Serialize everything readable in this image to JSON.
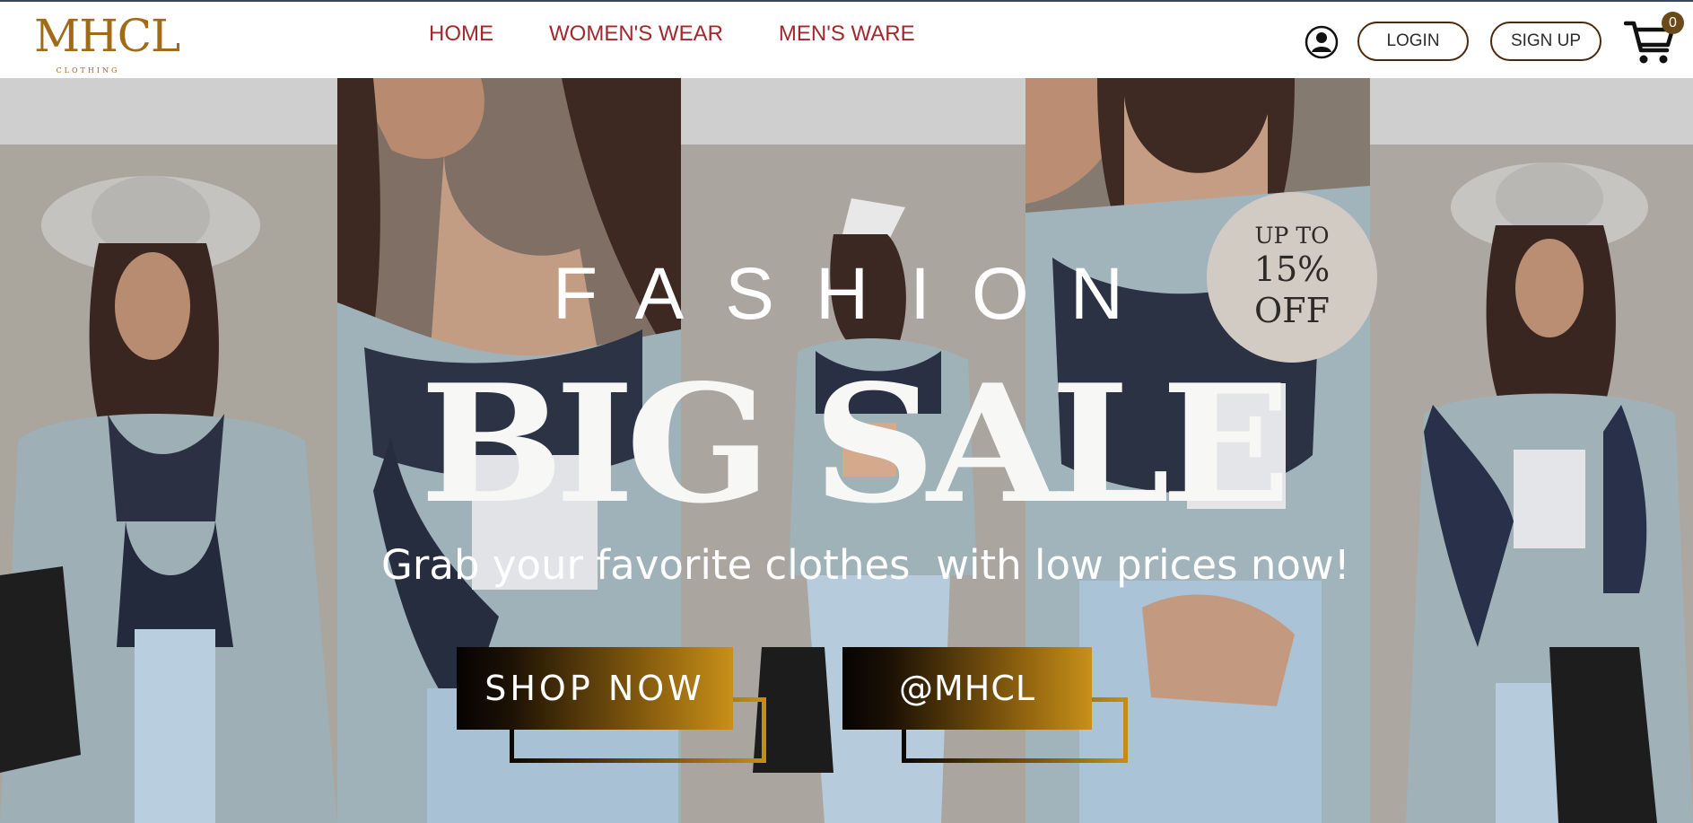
{
  "brand": {
    "logo_text": "MHCL",
    "logo_subtext": "CLOTHING",
    "accent_color": "#a06a16"
  },
  "nav": {
    "items": [
      {
        "label": "HOME"
      },
      {
        "label": "WOMEN'S WEAR"
      },
      {
        "label": "MEN'S WARE"
      }
    ],
    "link_color": "#a3282d"
  },
  "header_actions": {
    "user_icon": "user-circle-icon",
    "login_label": "LOGIN",
    "signup_label": "SIGN UP",
    "cart_icon": "shopping-cart-icon",
    "cart_count": "0"
  },
  "hero": {
    "eyebrow": "FASHION",
    "headline": "BIG SALE",
    "tagline": "Grab your favorite clothes  with low prices now!",
    "badge": {
      "line1": "UP TO",
      "line2": "15%",
      "line3": "OFF",
      "color": "#d2cbc4"
    },
    "cta_primary": "SHOP NOW",
    "cta_secondary": "@MHCL",
    "cta_gradient": [
      "#050302",
      "#c8901a"
    ]
  }
}
